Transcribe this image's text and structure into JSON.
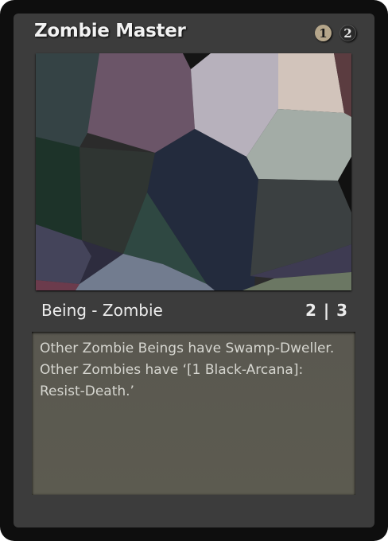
{
  "card": {
    "name": "Zombie Master",
    "mana_cost": [
      {
        "symbol": "1",
        "kind": "generic",
        "color": "#b5a68b"
      },
      {
        "symbol": "2",
        "kind": "black",
        "color": "#2a2a2a"
      }
    ],
    "type_line": "Being - Zombie",
    "power_toughness": "2 | 3",
    "rules_text": "Other Zombie Beings have Swamp-Dweller. Other Zombies have ‘[1 Black-Arcana]: Resist-Death.’"
  },
  "colors": {
    "frame_outer": "#0e0e0e",
    "frame_inner": "#3c3c3c",
    "text_box": "#5a5850"
  }
}
